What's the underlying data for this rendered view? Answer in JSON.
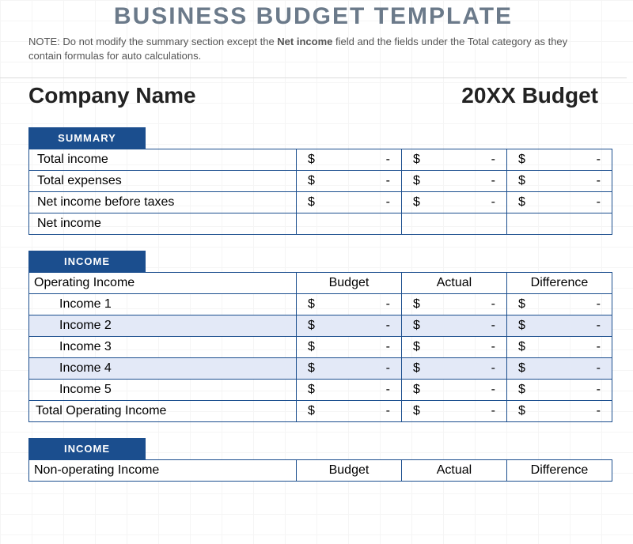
{
  "title": "BUSINESS BUDGET TEMPLATE",
  "note_prefix": "NOTE: Do not modify the summary section except the ",
  "note_bold": "Net income",
  "note_suffix": " field and the fields under the Total category as they contain formulas for auto calculations.",
  "header": {
    "company": "Company Name",
    "year": "20XX Budget"
  },
  "tabs": {
    "summary": "SUMMARY",
    "income1": "INCOME",
    "income2": "INCOME"
  },
  "summary": {
    "rows": [
      {
        "label": "Total income",
        "b": "-",
        "a": "-",
        "d": "-"
      },
      {
        "label": "Total expenses",
        "b": "-",
        "a": "-",
        "d": "-"
      },
      {
        "label": "Net income before taxes",
        "b": "-",
        "a": "-",
        "d": "-"
      },
      {
        "label": "Net income",
        "b": "",
        "a": "",
        "d": ""
      }
    ]
  },
  "income_section": {
    "heading": "Operating Income",
    "cols": {
      "budget": "Budget",
      "actual": "Actual",
      "diff": "Difference"
    },
    "rows": [
      {
        "label": "Income 1",
        "b": "-",
        "a": "-",
        "d": "-"
      },
      {
        "label": "Income 2",
        "b": "-",
        "a": "-",
        "d": "-",
        "alt": true
      },
      {
        "label": "Income 3",
        "b": "-",
        "a": "-",
        "d": "-"
      },
      {
        "label": "Income 4",
        "b": "-",
        "a": "-",
        "d": "-",
        "alt": true
      },
      {
        "label": "Income 5",
        "b": "-",
        "a": "-",
        "d": "-"
      }
    ],
    "total_label": "Total Operating Income",
    "total": {
      "b": "-",
      "a": "-",
      "d": "-"
    }
  },
  "nonop_section": {
    "heading": "Non-operating Income",
    "cols": {
      "budget": "Budget",
      "actual": "Actual",
      "diff": "Difference"
    }
  },
  "currency": "$"
}
